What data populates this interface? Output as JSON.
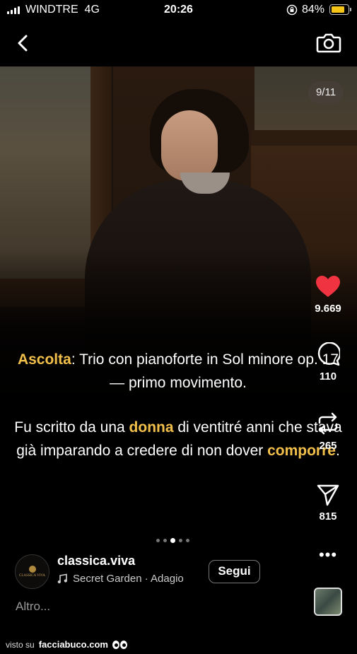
{
  "status_bar": {
    "carrier": "WINDTRE",
    "network": "4G",
    "time": "20:26",
    "battery_percent": "84%",
    "battery_level": 0.84,
    "battery_color": "#f5c518"
  },
  "nav": {
    "back_icon": "chevron-left-icon",
    "camera_icon": "camera-icon"
  },
  "post": {
    "image_counter": "9/11",
    "caption": {
      "p1_highlight": "Ascolta",
      "p1_rest": ": Trio con pianoforte in Sol minore op. 17 — primo movimento.",
      "p2_a": "Fu scritto da una ",
      "p2_hl1": "donna",
      "p2_b": " di ventitré anni che stava già imparando a credere di non dover ",
      "p2_hl2": "comporre",
      "p2_c": "."
    },
    "highlight_color": "#f2c04a",
    "carousel": {
      "total_dots": 5,
      "active_dot": 3
    }
  },
  "actions": {
    "likes": "9.669",
    "comments": "110",
    "reposts": "265",
    "shares": "815",
    "like_color": "#ef3340"
  },
  "author": {
    "username": "classica.viva",
    "avatar_text": "CLASSICA VIVA",
    "music": "Secret Garden · Adagio",
    "follow_label": "Segui",
    "more_label": "Altro...",
    "more_icon": "more-dots-icon"
  },
  "watermark": {
    "prefix": "visto su",
    "site": "facciabuco.com"
  }
}
